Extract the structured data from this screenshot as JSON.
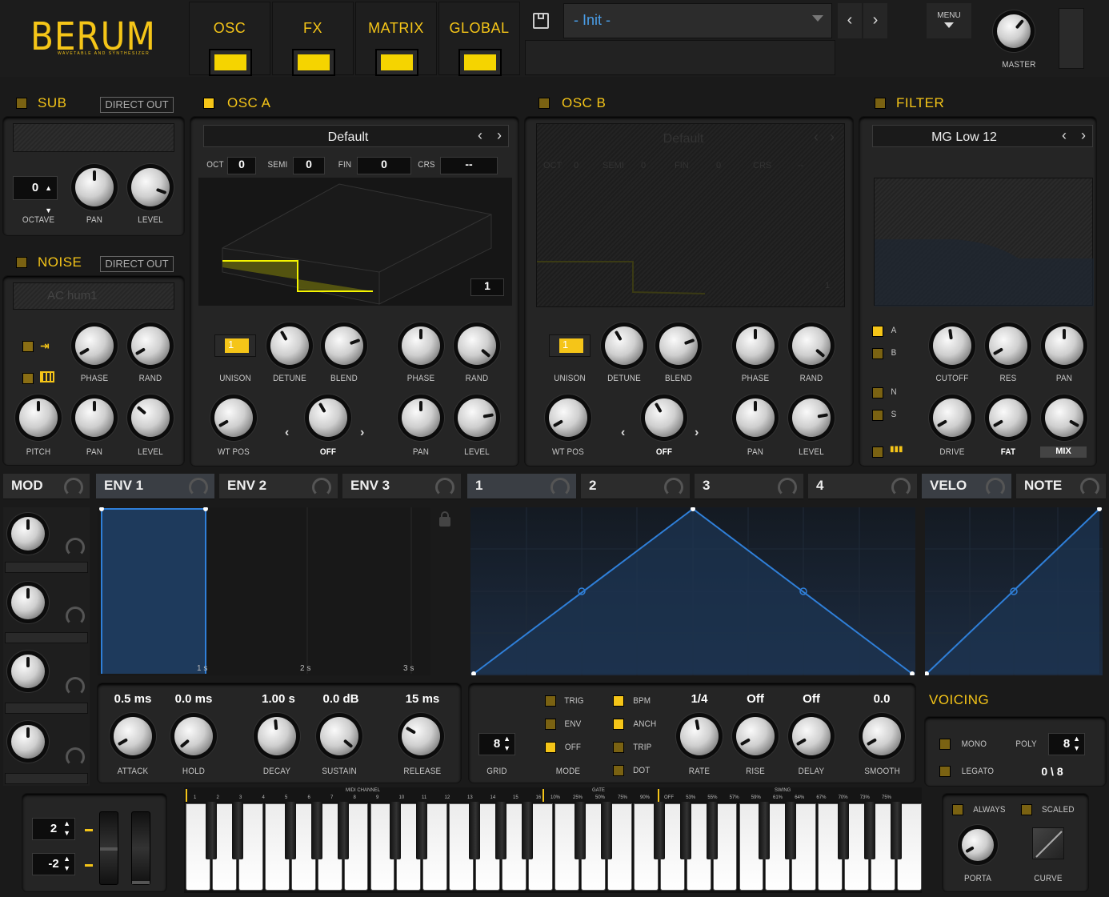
{
  "brand": {
    "name": "BERUM",
    "subtitle": "WAVETABLE AND SYNTHESIZER"
  },
  "topnav": [
    {
      "label": "OSC"
    },
    {
      "label": "FX"
    },
    {
      "label": "MATRIX"
    },
    {
      "label": "GLOBAL"
    }
  ],
  "preset": {
    "name": "- Init -",
    "menu": "MENU",
    "master": "MASTER"
  },
  "sub": {
    "title": "SUB",
    "direct": "DIRECT OUT",
    "octave_val": "0",
    "octave": "OCTAVE",
    "pan": "PAN",
    "level": "LEVEL"
  },
  "noise": {
    "title": "NOISE",
    "direct": "DIRECT OUT",
    "sample": "AC hum1",
    "phase": "PHASE",
    "rand": "RAND",
    "pitch": "PITCH",
    "pan": "PAN",
    "level": "LEVEL"
  },
  "osca": {
    "title": "OSC A",
    "table": "Default",
    "oct": "OCT",
    "oct_v": "0",
    "semi": "SEMI",
    "semi_v": "0",
    "fin": "FIN",
    "fin_v": "0",
    "crs": "CRS",
    "crs_v": "--",
    "frame": "1",
    "unison_v": "1",
    "unison": "UNISON",
    "detune": "DETUNE",
    "blend": "BLEND",
    "phase": "PHASE",
    "rand": "RAND",
    "wtpos": "WT POS",
    "off": "OFF",
    "pan": "PAN",
    "level": "LEVEL"
  },
  "oscb": {
    "title": "OSC B",
    "table": "Default",
    "oct": "OCT",
    "oct_v": "0",
    "semi": "SEMI",
    "semi_v": "0",
    "fin": "FIN",
    "fin_v": "0",
    "crs": "CRS",
    "crs_v": "--",
    "frame": "1",
    "unison_v": "1",
    "unison": "UNISON",
    "detune": "DETUNE",
    "blend": "BLEND",
    "phase": "PHASE",
    "rand": "RAND",
    "wtpos": "WT POS",
    "off": "OFF",
    "pan": "PAN",
    "level": "LEVEL"
  },
  "filter": {
    "title": "FILTER",
    "type": "MG Low 12",
    "a": "A",
    "b": "B",
    "n": "N",
    "s": "S",
    "cutoff": "CUTOFF",
    "res": "RES",
    "pan": "PAN",
    "drive": "DRIVE",
    "fat": "FAT",
    "mix": "MIX"
  },
  "tabs": [
    {
      "label": "MOD"
    },
    {
      "label": "ENV 1"
    },
    {
      "label": "ENV 2"
    },
    {
      "label": "ENV 3"
    },
    {
      "label": "1"
    },
    {
      "label": "2"
    },
    {
      "label": "3"
    },
    {
      "label": "4"
    },
    {
      "label": "VELO"
    },
    {
      "label": "NOTE"
    }
  ],
  "env": {
    "t1": "1 s",
    "t2": "2 s",
    "t3": "3 s",
    "attack_v": "0.5 ms",
    "hold_v": "0.0 ms",
    "decay_v": "1.00 s",
    "sustain_v": "0.0 dB",
    "release_v": "15 ms",
    "attack": "ATTACK",
    "hold": "HOLD",
    "decay": "DECAY",
    "sustain": "SUSTAIN",
    "release": "RELEASE"
  },
  "lfo": {
    "grid_v": "8",
    "grid": "GRID",
    "mode": "MODE",
    "trig": "TRIG",
    "env": "ENV",
    "off": "OFF",
    "bpm": "BPM",
    "anch": "ANCH",
    "trip": "TRIP",
    "dot": "DOT",
    "rate_v": "1/4",
    "rise_v": "Off",
    "delay_v": "Off",
    "smooth_v": "0.0",
    "rate": "RATE",
    "rise": "RISE",
    "delay": "DELAY",
    "smooth": "SMOOTH"
  },
  "voicing": {
    "title": "VOICING",
    "mono": "MONO",
    "poly": "POLY",
    "poly_v": "8",
    "legato": "LEGATO",
    "count": "0 \\ 8"
  },
  "wheels": {
    "up": "2",
    "down": "-2"
  },
  "porta": {
    "always": "ALWAYS",
    "scaled": "SCALED",
    "porta": "PORTA",
    "curve": "CURVE"
  },
  "keybar": {
    "midi": "MIDI CHANNEL",
    "gate": "GATE",
    "swing": "SWING",
    "midi_nums": [
      "1",
      "2",
      "3",
      "4",
      "5",
      "6",
      "7",
      "8",
      "9",
      "10",
      "11",
      "12",
      "13",
      "14",
      "15",
      "16"
    ],
    "gate_vals": [
      "10%",
      "25%",
      "50%",
      "75%",
      "90%"
    ],
    "swing_vals": [
      "OFF",
      "53%",
      "55%",
      "57%",
      "59%",
      "61%",
      "64%",
      "67%",
      "70%",
      "73%",
      "75%"
    ]
  },
  "colors": {
    "accent": "#f5c518",
    "blue": "#2f7fd8"
  }
}
